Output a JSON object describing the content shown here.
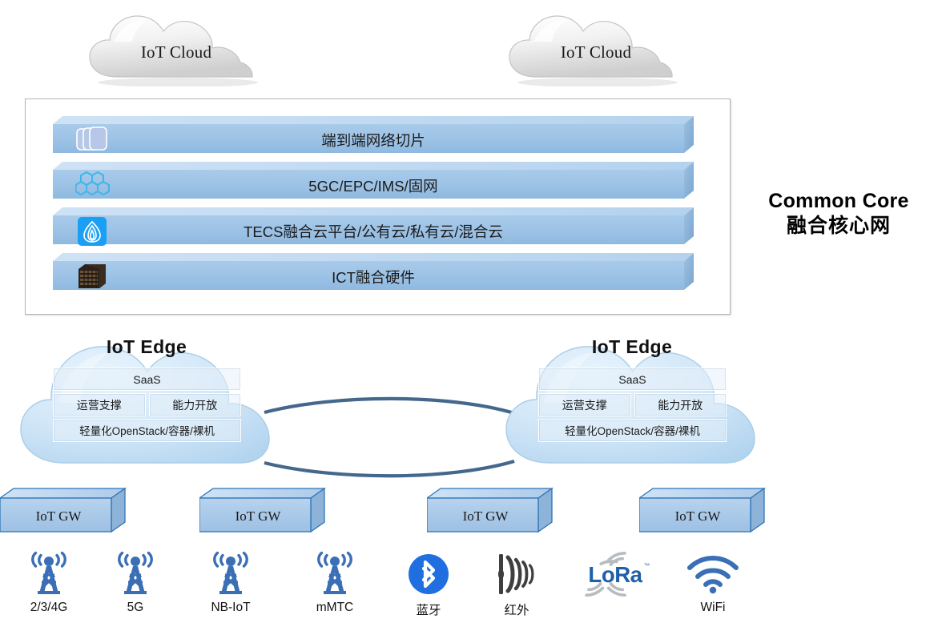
{
  "diagram": {
    "title": "IoT Architecture",
    "colors": {
      "bar_face": "#9dc3e6",
      "bar_top": "#bdd7ee",
      "bar_side": "#7ba7d0",
      "cloud_edge": "#b9d7ef",
      "gateway_face": "#a9c9e8",
      "gateway_border": "#2e75b6",
      "icon_blue": "#3b6fb5",
      "bluetooth_blue": "#1f6fe0",
      "lora_blue": "#1f5fa9",
      "infrared_gray": "#4a4a4a",
      "text_dark": "#111111",
      "container_border": "#b4b4b4"
    }
  },
  "iot_clouds": [
    {
      "label": "IoT Cloud"
    },
    {
      "label": "IoT Cloud"
    }
  ],
  "common_core": {
    "title_en": "Common Core",
    "title_cn": "融合核心网",
    "layers": [
      {
        "label": "端到端网络切片",
        "icon": "network-slices-icon"
      },
      {
        "label": "5GC/EPC/IMS/固网",
        "icon": "honeycomb-icon"
      },
      {
        "label": "TECS融合云平台/公有云/私有云/混合云",
        "icon": "tecs-cloud-icon"
      },
      {
        "label": "ICT融合硬件",
        "icon": "server-rack-icon"
      }
    ]
  },
  "iot_edges": [
    {
      "title": "IoT Edge",
      "saas": "SaaS",
      "middle": [
        "运营支撑",
        "能力开放"
      ],
      "base": "轻量化OpenStack/容器/裸机"
    },
    {
      "title": "IoT Edge",
      "saas": "SaaS",
      "middle": [
        "运营支撑",
        "能力开放"
      ],
      "base": "轻量化OpenStack/容器/裸机"
    }
  ],
  "gateways": [
    {
      "label": "IoT  GW"
    },
    {
      "label": "IoT  GW"
    },
    {
      "label": "IoT  GW"
    },
    {
      "label": "IoT  GW"
    }
  ],
  "technologies": [
    {
      "label": "2/3/4G",
      "icon": "cell-tower-icon"
    },
    {
      "label": "5G",
      "icon": "cell-tower-icon"
    },
    {
      "label": "NB-IoT",
      "icon": "cell-tower-icon"
    },
    {
      "label": "mMTC",
      "icon": "cell-tower-icon"
    },
    {
      "label": "蓝牙",
      "icon": "bluetooth-icon"
    },
    {
      "label": "红外",
      "icon": "infrared-icon"
    },
    {
      "label": "",
      "icon": "lora-logo-icon"
    },
    {
      "label": "WiFi",
      "icon": "wifi-icon"
    }
  ]
}
